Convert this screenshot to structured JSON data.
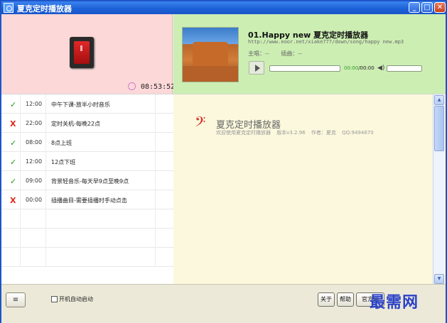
{
  "window": {
    "title": "夏克定时播放器"
  },
  "clock": {
    "time": "08:53:52"
  },
  "player": {
    "song_title": "01.Happy new 夏克定时播放器",
    "song_url": "http://www.eoor.net/xiake777/down/song/happy new.mp3",
    "singer_label": "主唱：--",
    "album_label": "插曲：--",
    "time_current": "00:00",
    "time_total": "/00:00",
    "progress": 0
  },
  "tasks": [
    {
      "status": "✓",
      "status_type": "ok",
      "time": "12:00",
      "name": "中午下课-放半小时音乐"
    },
    {
      "status": "X",
      "status_type": "off",
      "time": "22:00",
      "name": "定时关机-每晚22点"
    },
    {
      "status": "✓",
      "status_type": "ok",
      "time": "08:00",
      "name": "8点上班"
    },
    {
      "status": "✓",
      "status_type": "ok",
      "time": "12:00",
      "name": "12点下班"
    },
    {
      "status": "✓",
      "status_type": "ok",
      "time": "09:00",
      "name": "背景轻音乐-每天早9点至晚9点"
    },
    {
      "status": "X",
      "status_type": "off",
      "time": "00:00",
      "name": "插播曲目-需要插播时手动点击"
    }
  ],
  "info": {
    "title": "夏克定时播放器",
    "welcome": "欢迎使用夏克定时播放器",
    "version": "版本v3.2.96",
    "author": "作者：夏克",
    "qq": "QQ:9494670"
  },
  "bottom": {
    "menu_label": "≡",
    "autostart_label": "开机自动启动",
    "about_label": "关于",
    "help_label": "帮助",
    "site_label": "官方网"
  },
  "watermark": "最需网",
  "colors": {
    "title_bar": "#1c5fd6",
    "clock_bg": "#fcd8d8",
    "player_bg": "#cceeb3",
    "info_bg": "#fbf8dd",
    "status_ok": "#1e9a1e",
    "status_off": "#d92a1a",
    "current_time": "#2f9a22"
  }
}
